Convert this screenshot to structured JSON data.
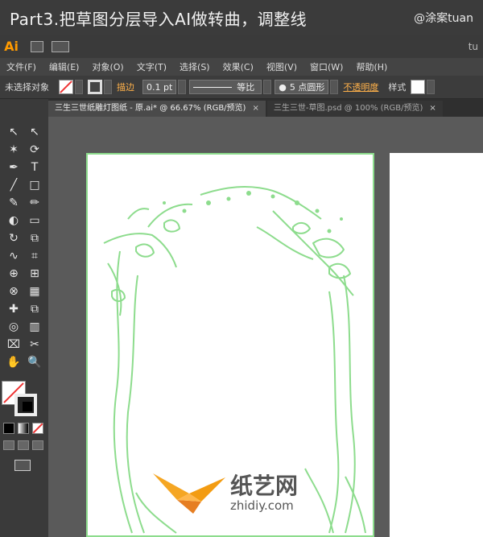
{
  "banner": {
    "title": "Part3.把草图分层导入AI做转曲，调整线",
    "author": "@涂案tuan"
  },
  "app": {
    "logo": "Ai",
    "truncated_right": "tu"
  },
  "menu": [
    "文件(F)",
    "编辑(E)",
    "对象(O)",
    "文字(T)",
    "选择(S)",
    "效果(C)",
    "视图(V)",
    "窗口(W)",
    "帮助(H)"
  ],
  "control_bar": {
    "selection": "未选择对象",
    "stroke_label": "描边",
    "stroke_weight": "0.1 pt",
    "line_style": "等比",
    "brush": "5 点圆形",
    "opacity_label": "不透明度",
    "style_label": "样式"
  },
  "tabs": [
    {
      "label": "三生三世纸雕灯图纸 - 原.ai* @ 66.67% (RGB/预览)",
      "close": "×"
    },
    {
      "label": "三生三世-草图.psd @ 100% (RGB/预览)",
      "close": "×"
    }
  ],
  "tools": [
    "selection-tool-icon",
    "direct-selection-tool-icon",
    "magic-wand-icon",
    "lasso-icon",
    "pen-tool-icon",
    "type-tool-icon",
    "line-tool-icon",
    "rectangle-tool-icon",
    "paintbrush-icon",
    "pencil-icon",
    "blob-brush-icon",
    "eraser-icon",
    "rotate-tool-icon",
    "scale-tool-icon",
    "warp-tool-icon",
    "free-transform-icon",
    "shape-builder-icon",
    "perspective-grid-icon",
    "mesh-tool-icon",
    "gradient-tool-icon",
    "eyedropper-icon",
    "blend-tool-icon",
    "symbol-sprayer-icon",
    "graph-tool-icon",
    "artboard-tool-icon",
    "slice-tool-icon",
    "hand-tool-icon",
    "zoom-tool-icon"
  ],
  "tool_glyphs": [
    "↖",
    "↖",
    "✶",
    "⟳",
    "✒",
    "T",
    "╱",
    "□",
    "✎",
    "✏",
    "◐",
    "▭",
    "↻",
    "⧉",
    "∿",
    "⌗",
    "⊕",
    "⊞",
    "⊗",
    "▦",
    "✚",
    "⧉",
    "◎",
    "▥",
    "⌧",
    "✂",
    "✋",
    "🔍"
  ],
  "watermark": {
    "main": "纸艺网",
    "sub": "zhidiy.com"
  },
  "colors": {
    "accent_orange": "#ff9a00",
    "sketch_green": "#8ddc8d"
  }
}
